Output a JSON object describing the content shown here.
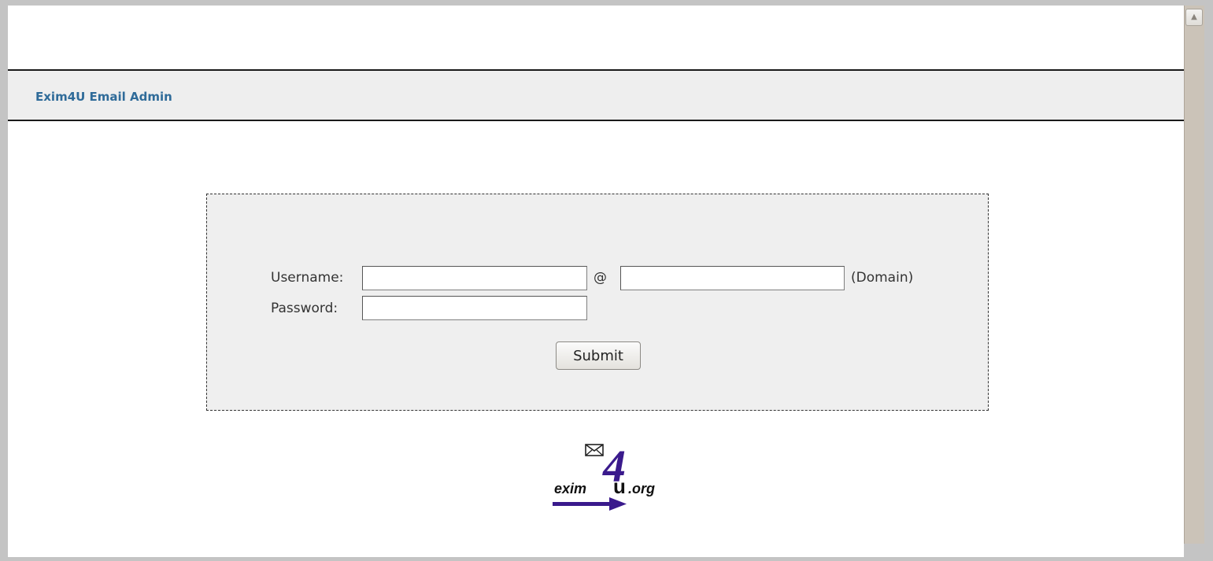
{
  "header": {
    "title": "Exim4U Email Admin"
  },
  "login": {
    "username_label": "Username:",
    "username_value": "",
    "at_sign": "@",
    "domain_value": "",
    "domain_hint": "(Domain)",
    "password_label": "Password:",
    "password_value": "",
    "submit_label": "Submit"
  },
  "logo": {
    "text_left": "exim",
    "text_number": "4",
    "text_u": "u",
    "text_suffix": ".org",
    "icon": "envelope-icon"
  },
  "colors": {
    "title": "#2f6b99",
    "header_bg": "#eeeeee",
    "box_bg": "#efefef",
    "logo_purple": "#3a1a8c"
  }
}
